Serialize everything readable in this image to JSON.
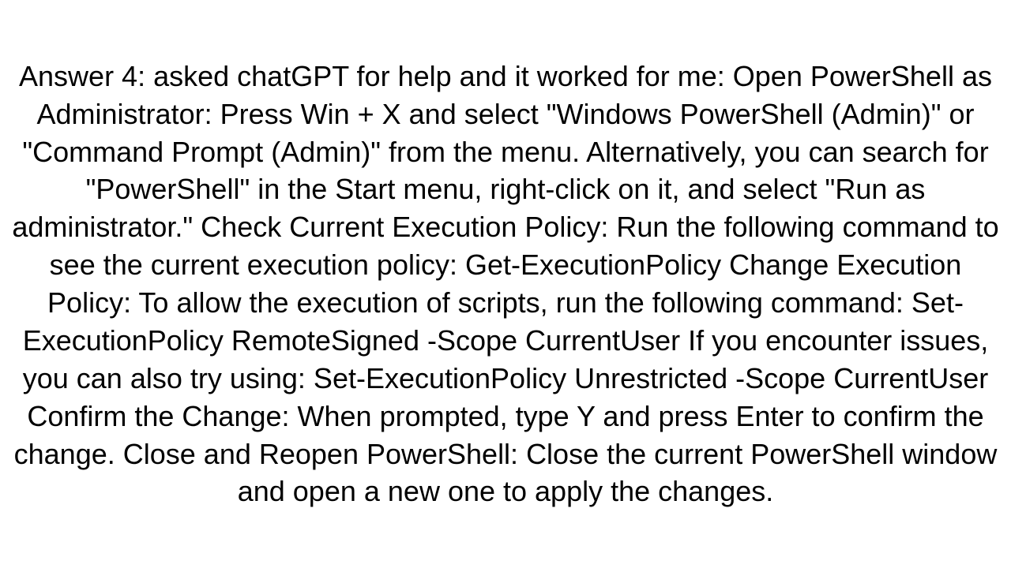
{
  "content": {
    "body_text": "Answer 4: asked chatGPT for help and it worked for me: Open PowerShell as Administrator: Press Win + X and select \"Windows PowerShell (Admin)\" or \"Command Prompt (Admin)\" from the menu. Alternatively, you can search for \"PowerShell\" in the Start menu, right-click on it, and select \"Run as administrator.\" Check Current Execution Policy: Run the following command to see the current execution policy: Get-ExecutionPolicy Change Execution Policy: To allow the execution of scripts, run the following command: Set-ExecutionPolicy RemoteSigned -Scope CurrentUser If you encounter issues, you can also try using: Set-ExecutionPolicy Unrestricted -Scope CurrentUser Confirm the Change: When prompted, type Y and press Enter to confirm the change. Close and Reopen PowerShell: Close the current PowerShell window and open a new one to apply the changes."
  }
}
